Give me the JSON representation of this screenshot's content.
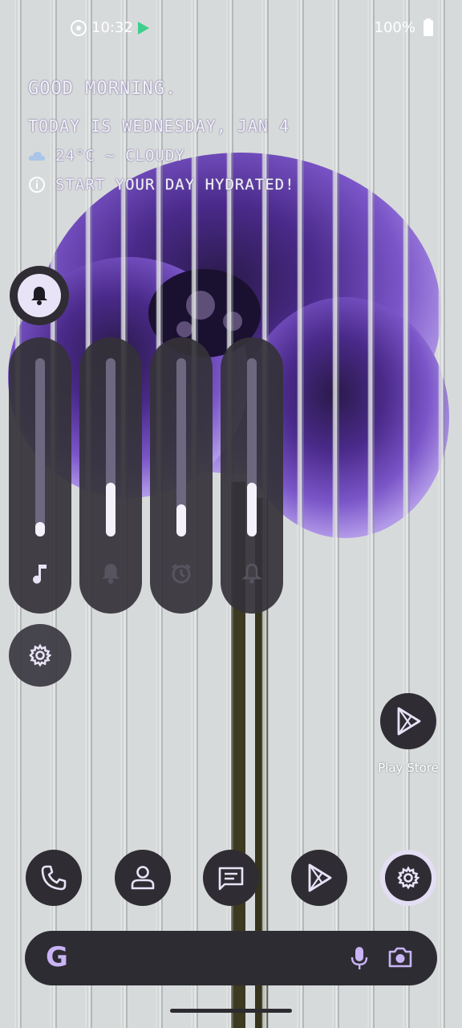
{
  "status_bar": {
    "time": "10:32",
    "battery": "100%",
    "icons": [
      "record-indicator-icon",
      "play-store-notification-icon",
      "battery-full-icon"
    ]
  },
  "greeting": {
    "line1": "GOOD MORNING.",
    "line2": "TODAY IS WEDNESDAY, JAN 4",
    "weather": "24°C ~ CLOUDY",
    "tip": "START YOUR DAY HYDRATED!"
  },
  "volume_panel": {
    "ringer_icon": "bell-icon",
    "sliders": [
      {
        "name": "media",
        "icon": "music-note-icon",
        "level": 0.08
      },
      {
        "name": "ring",
        "icon": "bell-icon",
        "level": 0.3
      },
      {
        "name": "alarm",
        "icon": "alarm-icon",
        "level": 0.18
      },
      {
        "name": "notification",
        "icon": "bell-outline-icon",
        "level": 0.3
      }
    ],
    "settings_icon": "gear-icon"
  },
  "shortcut": {
    "label": "Play Store",
    "icon": "play-store-icon"
  },
  "dock": [
    {
      "name": "phone",
      "icon": "phone-icon"
    },
    {
      "name": "contacts",
      "icon": "person-icon"
    },
    {
      "name": "messages",
      "icon": "message-icon"
    },
    {
      "name": "play-store",
      "icon": "play-store-icon"
    },
    {
      "name": "settings",
      "icon": "gear-icon"
    }
  ],
  "search": {
    "logo": "G",
    "placeholder": "",
    "mic_icon": "mic-icon",
    "lens_icon": "camera-icon"
  },
  "colors": {
    "accent": "#c9b4f5",
    "panel": "#343238",
    "fill": "#f4f1fa",
    "track": "#6d6780"
  }
}
